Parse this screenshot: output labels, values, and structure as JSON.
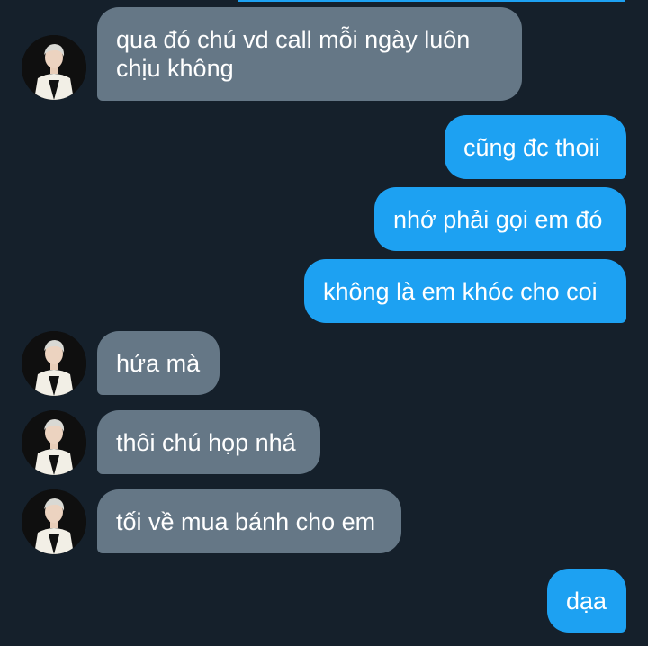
{
  "colors": {
    "background": "#15202b",
    "incoming_bubble": "#657786",
    "outgoing_bubble": "#1da1f2",
    "text": "#ffffff"
  },
  "messages": [
    {
      "direction": "incoming",
      "text": "qua đó chú vd call mỗi ngày luôn chịu không",
      "avatar_icon": "profile-avatar"
    },
    {
      "direction": "outgoing",
      "text": "cũng đc thoii"
    },
    {
      "direction": "outgoing",
      "text": "nhớ phải gọi em đó"
    },
    {
      "direction": "outgoing",
      "text": "không là em khóc cho coi"
    },
    {
      "direction": "incoming",
      "text": "hứa mà",
      "avatar_icon": "profile-avatar"
    },
    {
      "direction": "incoming",
      "text": "thôi chú họp nhá",
      "avatar_icon": "profile-avatar"
    },
    {
      "direction": "incoming",
      "text": "tối về mua bánh cho em",
      "avatar_icon": "profile-avatar"
    },
    {
      "direction": "outgoing",
      "text": "dạa"
    }
  ]
}
